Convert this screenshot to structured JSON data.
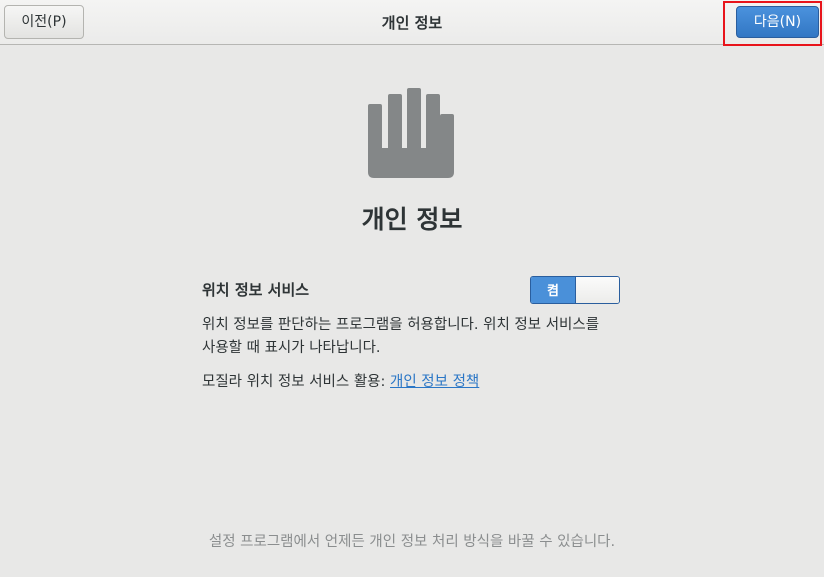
{
  "header": {
    "prev_label": "이전(P)",
    "title": "개인 정보",
    "next_label": "다음(N)"
  },
  "main": {
    "icon": "hand-stop-icon",
    "title": "개인 정보",
    "location": {
      "label": "위치 정보 서비스",
      "toggle_label": "켬",
      "enabled": true
    },
    "description_line1": "위치 정보를 판단하는 프로그램을 허용합니다. 위치 정보 서비스를",
    "description_line2": "사용할 때 표시가 나타납니다.",
    "policy_prefix": "모질라 위치 정보 서비스 활용: ",
    "policy_link": "개인 정보 정책"
  },
  "footer": {
    "note": "설정 프로그램에서 언제든 개인 정보 처리 방식을 바꿀 수 있습니다."
  },
  "colors": {
    "accent": "#3b84d3",
    "highlight": "#e8141b",
    "icon": "#848788",
    "link": "#2a76c6"
  }
}
